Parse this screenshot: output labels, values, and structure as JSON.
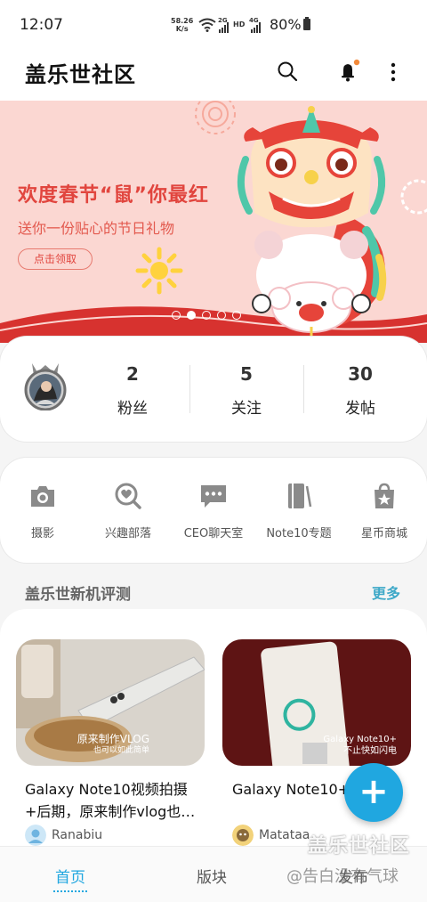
{
  "status_bar": {
    "time": "12:07",
    "net_speed_value": "58.26",
    "net_speed_unit": "K/s",
    "wifi_icon": "wifi-icon",
    "signal_label_2g": "2G",
    "hd_label": "HD",
    "signal_label_4g": "4G",
    "battery_pct": "80%"
  },
  "app_bar": {
    "title": "盖乐世社区",
    "icons": [
      "search-icon",
      "bell-icon",
      "more-vertical-icon"
    ],
    "notification_dot_color": "#f28a3b"
  },
  "banner": {
    "headline": "欢度春节“鼠”你最红",
    "subtitle": "送你一份贴心的节日礼物",
    "cta": "点击领取",
    "page_count": 5,
    "current_page": 2
  },
  "profile_stats": [
    {
      "value": "2",
      "label": "粉丝"
    },
    {
      "value": "5",
      "label": "关注"
    },
    {
      "value": "30",
      "label": "发帖"
    }
  ],
  "shortcuts": [
    {
      "label": "摄影",
      "icon": "camera-icon"
    },
    {
      "label": "兴趣部落",
      "icon": "heart-search-icon"
    },
    {
      "label": "CEO聊天室",
      "icon": "chat-bubble-icon"
    },
    {
      "label": "Note10专题",
      "icon": "phone-pen-icon"
    },
    {
      "label": "星币商城",
      "icon": "shopping-bag-star-icon"
    }
  ],
  "section": {
    "title": "盖乐世新机评测",
    "more": "更多"
  },
  "posts": [
    {
      "title": "Galaxy Note10视频拍摄+后期，原来制作vlog也…",
      "author": "Ranabiu",
      "img_caption_1": "原来制作VLOG",
      "img_caption_2": "也可以如此简单"
    },
    {
      "title": "Galaxy Note10+如闪电",
      "author": "Matataa",
      "img_caption_1": "Galaxy Note10+",
      "img_caption_2": "不止快如闪电"
    }
  ],
  "fab_label": "+",
  "bottom_nav": [
    {
      "label": "首页",
      "active": true
    },
    {
      "label": "版块",
      "active": false
    },
    {
      "label": "发布",
      "active": false
    }
  ],
  "watermark": {
    "line1": "盖乐世社区",
    "line2": "@告白没有气球"
  },
  "colors": {
    "accent": "#20a7e0",
    "banner_red": "#e1453e",
    "banner_bg": "#fbd7d2",
    "more_link": "#3fa9c8"
  }
}
